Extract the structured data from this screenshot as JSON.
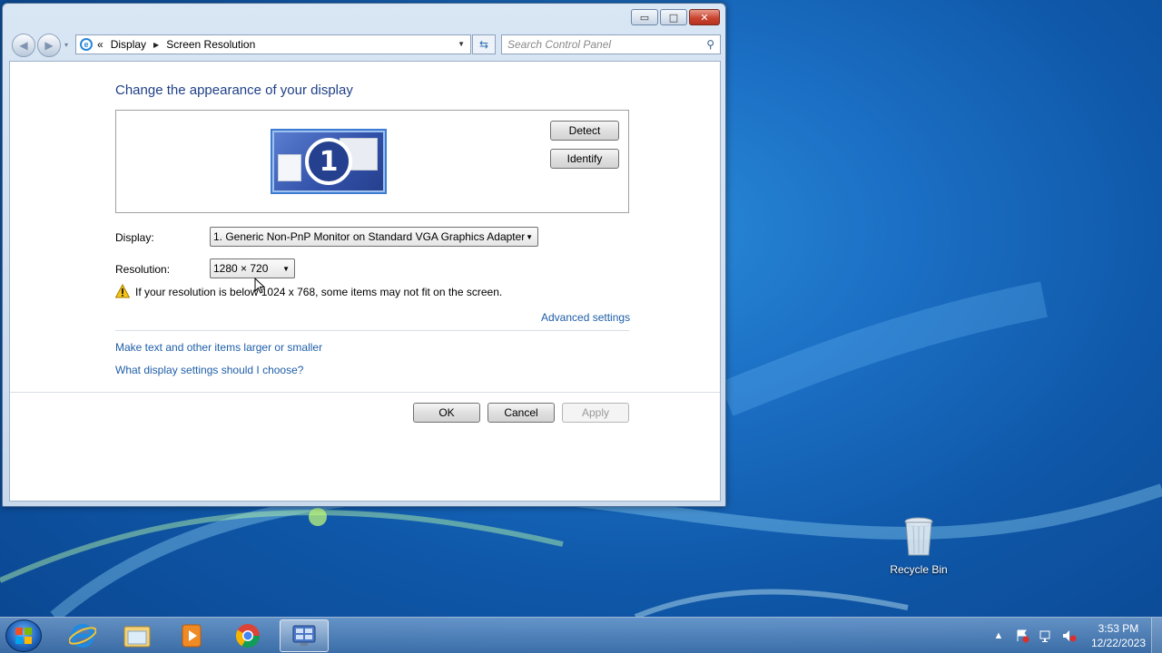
{
  "window": {
    "controls": {
      "minimize": "▭",
      "maximize": "□",
      "close": "✕"
    },
    "nav": {
      "back_symbol": "◀",
      "forward_symbol": "▶",
      "dropdown_symbol": "▾",
      "chevrons": "«",
      "breadcrumb": [
        "Display",
        "Screen Resolution"
      ],
      "search_placeholder": "Search Control Panel"
    },
    "content": {
      "title": "Change the appearance of your display",
      "monitor_number": "1",
      "detect_label": "Detect",
      "identify_label": "Identify",
      "display_label": "Display:",
      "display_value": "1. Generic Non-PnP Monitor on Standard VGA Graphics Adapter",
      "resolution_label": "Resolution:",
      "resolution_value": "1280 × 720",
      "warning_text": "If your resolution is below 1024 x 768, some items may not fit on the screen.",
      "advanced_link": "Advanced settings",
      "link_text_size": "Make text and other items larger or smaller",
      "link_help": "What display settings should I choose?",
      "ok_label": "OK",
      "cancel_label": "Cancel",
      "apply_label": "Apply"
    }
  },
  "desktop": {
    "recycle_bin_label": "Recycle Bin"
  },
  "taskbar": {
    "icons": [
      "windows-start-icon",
      "internet-explorer-icon",
      "file-explorer-icon",
      "media-player-icon",
      "chrome-icon",
      "control-panel-icon"
    ],
    "clock_time": "3:53 PM",
    "clock_date": "12/22/2023",
    "tray_icons": [
      "show-hidden-icons",
      "action-center-icon",
      "network-icon",
      "volume-muted-icon"
    ]
  },
  "colors": {
    "accent_link": "#1e5ea8",
    "title_blue": "#1e3f87",
    "desktop_blue": "#1b6fc4"
  }
}
